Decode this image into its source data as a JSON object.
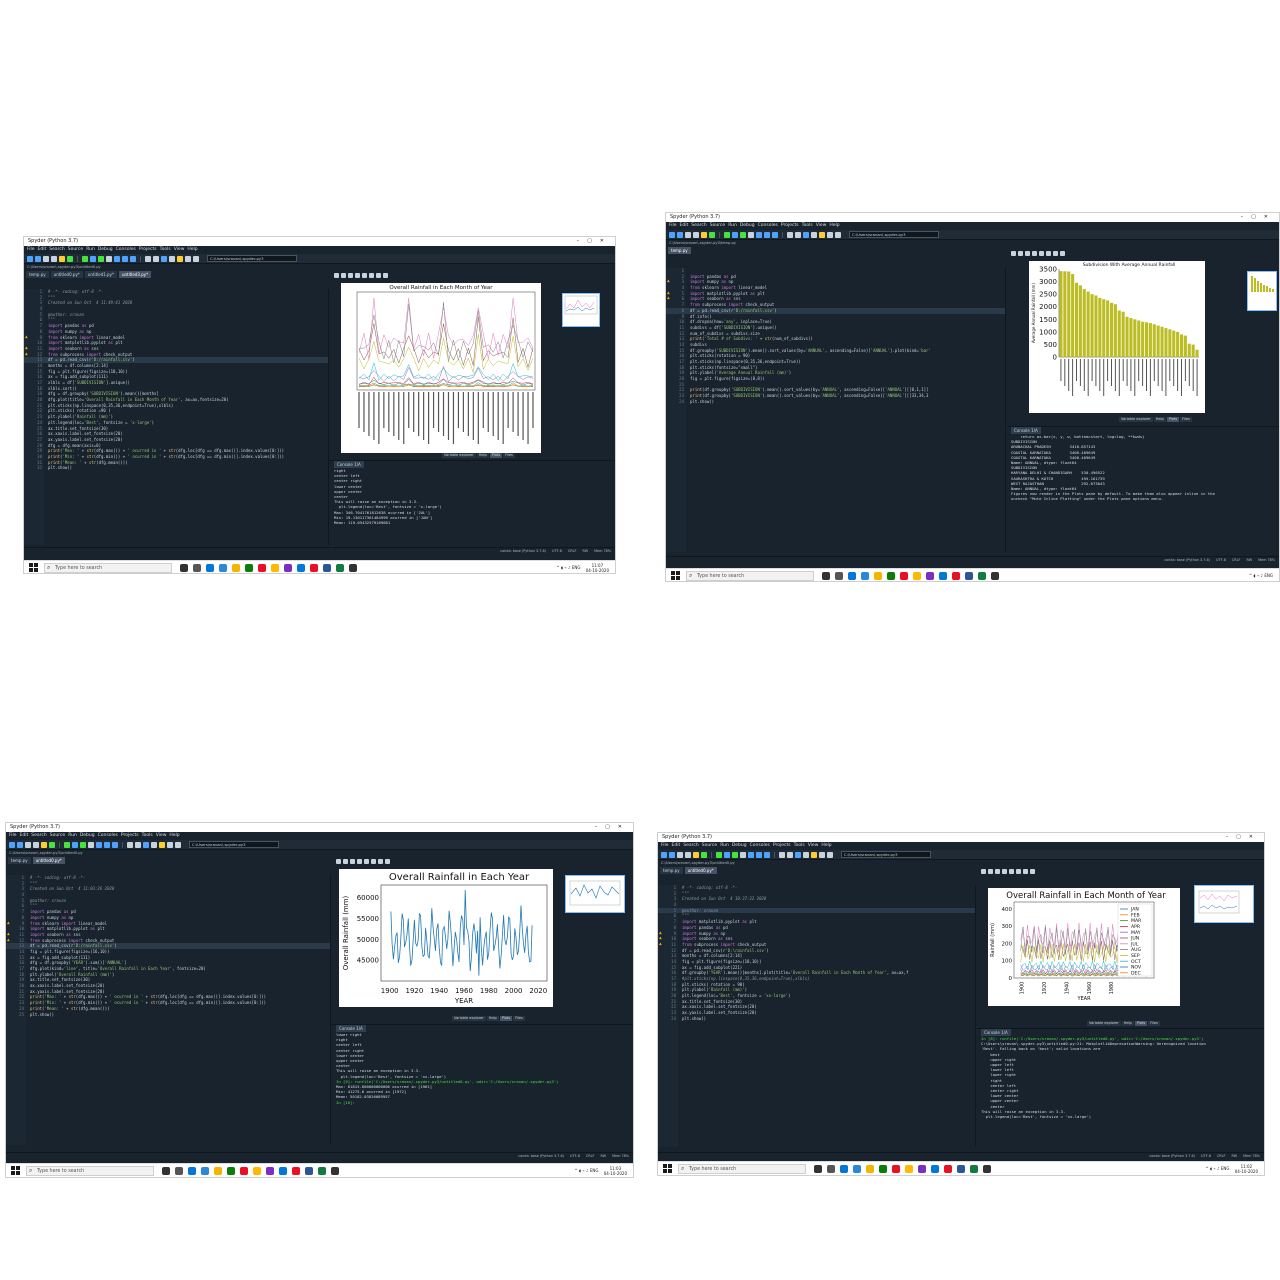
{
  "app_title": "Spyder (Python 3.7)",
  "menu": [
    "File",
    "Edit",
    "Search",
    "Source",
    "Run",
    "Debug",
    "Consoles",
    "Projects",
    "Tools",
    "View",
    "Help"
  ],
  "cwd": "C:\\Users\\sravan\\.spyder-py3",
  "taskbar": {
    "search_placeholder": "Type here to search",
    "lang": "ENG"
  },
  "status": {
    "interpreter": "conda: base (Python 3.7.6)",
    "enc": "UTF-8",
    "eol": "CRLF",
    "perm": "RW",
    "mem": "Mem 78%"
  },
  "plot_tabs": [
    "Variable explorer",
    "Help",
    "Plots",
    "Files"
  ],
  "console_tabs": [
    "Python console",
    "History"
  ],
  "screens": [
    {
      "editor_file": "C:\\Users\\sravan\\.spyder-py3\\untitled0.py",
      "tabs": [
        "temp.py",
        "untitled0.py*",
        "untitled1.py*",
        "untitled3.py*"
      ],
      "code": [
        "# -*- coding: utf-8 -*-",
        "\"\"\"",
        "Created on Sun Oct  4 11:49:41 2020",
        "",
        "@author: sravan",
        "\"\"\"",
        "import pandas as pd",
        "import numpy as np",
        "from sklearn import linear_model",
        "import matplotlib.pyplot as plt",
        "import seaborn as sns",
        "from subprocess import check_output",
        "df = pd.read_csv(r'D:/rainfall.csv')",
        "months = df.columns[2:14]",
        "fig = plt.figure(figsize=(18,10))",
        "ax = fig.add_subplot(111)",
        "xlbls = df['SUBDIVISION'].unique()",
        "xlbls.sort()",
        "dfg = df.groupby('SUBDIVISION').mean()[months]",
        "dfg.plot(title='Overall Rainfall in Each Month of Year', ax=ax,fontsize=20)",
        "plt.xticks(np.linspace(0,35,36,endpoint=True),xlbls)",
        "plt.xticks( rotation =90 )",
        "plt.ylabel('Rainfall (mm)')",
        "plt.legend(loc='Best', fontsize = 'x-large')",
        "ax.title.set_fontsize(30)",
        "ax.xaxis.label.set_fontsize(20)",
        "ax.yaxis.label.set_fontsize(20)",
        "dfg = dfg.mean(axis=0)",
        "print('Max: ' + str(dfg.max()) + ' ocurred in ' + str(dfg.loc[dfg == dfg.max()].index.values[0:]))",
        "print('Min: ' + str(dfg.min()) + ' ocurred in ' + str(dfg.loc[dfg == dfg.min()].index.values[0:]))",
        "print('Mean: ' + str(dfg.mean()))",
        "plt.show()"
      ],
      "plot_title": "Overall Rainfall in Each Month of Year",
      "console": [
        "right",
        "center left",
        "center right",
        "lower center",
        "upper center",
        "center",
        "This will raise an exception in 3.3.",
        "  plt.legend(loc='Best', fontsize = 'x-large')",
        "Max: 346.7041761812638 ocurred in ['JUL']",
        "Min: 19.130117361484999 ocurred in ['JAN']",
        "Mean: 119.05432579109881"
      ],
      "time": "11:07",
      "date": "04-10-2020"
    },
    {
      "editor_file": "C:\\Users\\sravan\\.spyder-py3\\temp.py",
      "tabs": [
        "temp.py"
      ],
      "code": [
        "",
        "import pandas as pd",
        "import numpy as np",
        "from sklearn import linear_model",
        "import matplotlib.pyplot as plt",
        "import seaborn as sns",
        "from subprocess import check_output",
        "df = pd.read_csv(r'D:/rainfall.csv')",
        "df.info()",
        "df.dropna(how='any', inplace=True)",
        "subdivs = df['SUBDIVISION'].unique()",
        "num_of_subdivs = subdivs.size",
        "print('Total # of Subdivs: ' + str(num_of_subdivs))",
        "subdivs",
        "df.groupby('SUBDIVISION').mean().sort_values(by='ANNUAL', ascending=False)['ANNUAL'].plot(kind='bar'",
        "plt.xticks(rotation = 90)",
        "plt.xticks(np.linspace(0,35,36,endpoint=True))",
        "plt.xticks(fontsize=\"small\")",
        "plt.ylabel('Average Annual Rainfall (mm)')",
        "fig = plt.figure(figsize=(8,8))",
        "",
        "print(df.groupby('SUBDIVISION').mean().sort_values(by='ANNUAL', ascending=False)['ANNUAL'][[0,1,1]]",
        "print(df.groupby('SUBDIVISION').mean().sort_values(by='ANNUAL', ascending=False)['ANNUAL'][[33,34,3",
        "plt.show()"
      ],
      "plot_title": "Subdivision With Average Annual Rainfall",
      "bar_values": [
        3418,
        3410,
        3400,
        3300,
        2950,
        2850,
        2700,
        2600,
        2500,
        2450,
        2350,
        2300,
        2250,
        2150,
        2100,
        1850,
        1800,
        1600,
        1550,
        1500,
        1450,
        1400,
        1380,
        1350,
        1300,
        1250,
        1200,
        1150,
        1100,
        1050,
        1000,
        900,
        850,
        530,
        495,
        292
      ],
      "yticks": [
        "3500",
        "3000",
        "2500",
        "2000",
        "1500",
        "1000",
        "500",
        "0"
      ],
      "ylabel": "Average Annual Rainfall (mm)",
      "console": [
        "    return ax.bar(x, y, w, bottom=start, log=log, **kwds)",
        "SUBDIVISION",
        "ARUNACHAL PRADESH        3418.857143",
        "COASTAL KARNATAKA        3408.409649",
        "COASTAL KARNATAKA        3408.409649",
        "Name: ANNUAL, dtype: float64",
        "SUBDIVISION",
        "HARYANA DELHI & CHANDIGARH    530.496522",
        "SAURASHTRA & KUTCH            495.161739",
        "WEST RAJASTHAN                292.673043",
        "Name: ANNUAL, dtype: float64",
        "",
        "",
        "Figures now render in the Plots pane by default. To make them also appear inline in the",
        "uncheck \"Mute Inline Plotting\" under the Plots pane options menu."
      ],
      "time": "",
      "date": ""
    },
    {
      "editor_file": "C:\\Users\\sravan\\.spyder-py3\\untitled0.py",
      "tabs": [
        "temp.py",
        "untitled0.py*"
      ],
      "code": [
        "# -*- coding: utf-8 -*-",
        "\"\"\"",
        "Created on Sun Oct  4 11:03:26 2020",
        "",
        "@author: sravan",
        "\"\"\"",
        "import pandas as pd",
        "import numpy as np",
        "from sklearn import linear_model",
        "import matplotlib.pyplot as plt",
        "import seaborn as sns",
        "from subprocess import check_output",
        "df = pd.read_csv(r'D:/rainfall.csv')",
        "fig = plt.figure(figsize=(16,10))",
        "ax = fig.add_subplot(111)",
        "dfg = df.groupby('YEAR').sum()['ANNUAL']",
        "dfg.plot(kind='line', title='Overall Rainfall in Each Year', fontsize=20)",
        "plt.ylabel('Overall Rainfall (mm)')",
        "ax.title.set_fontsize(30)",
        "ax.xaxis.label.set_fontsize(20)",
        "ax.yaxis.label.set_fontsize(20)",
        "print('Max: ' + str(dfg.max()) + ' ocurred in ' + str(dfg.loc[dfg == dfg.max()].index.values[0:]))",
        "print('Min: ' + str(dfg.min()) + ' ocurred in ' + str(dfg.loc[dfg == dfg.min()].index.values[0:]))",
        "print('Mean: ' + str(dfg.mean()))",
        "plt.show()"
      ],
      "plot_title": "Overall Rainfall in Each Year",
      "ylabel": "Overall Rainfall (mm)",
      "xlabel": "YEAR",
      "xticks": [
        "1900",
        "1920",
        "1940",
        "1960",
        "1980",
        "2000",
        "2020"
      ],
      "yticks": [
        "60000",
        "55000",
        "50000",
        "45000"
      ],
      "console": [
        "lower right",
        "right",
        "center left",
        "center right",
        "lower center",
        "upper center",
        "center",
        "This will raise an exception in 3.3.",
        "  plt.legend(loc='Best', fontsize = 'xx-large')",
        "",
        "In [9]: runfile('C:/Users/sravan/.spyder-py3/untitled0.py', wdir='C:/Users/sravan/.spyder-py3')",
        "Max: 61815.600000000006 ocurred in [1961]",
        "Min: 41275.6 ocurred in [1972]",
        "Mean: 50182.03826089957",
        "",
        "In [10]:"
      ],
      "time": "11:03",
      "date": "04-10-2020"
    },
    {
      "editor_file": "C:\\Users\\sravan\\.spyder-py3\\untitled0.py",
      "tabs": [
        "temp.py",
        "untitled0.py*"
      ],
      "code": [
        "# -*- coding: utf-8 -*-",
        "\"\"\"",
        "Created on Sun Oct  4 10:37:32 2020",
        "",
        "@author: sravan",
        "\"\"\"",
        "import matplotlib.pyplot as plt",
        "import pandas as pd",
        "import numpy as np",
        "import seaborn as sns",
        "from subprocess import check_output",
        "df = pd.read_csv(r'D:\\rainfall.csv')",
        "months = df.columns[2:14]",
        "fig = plt.figure(figsize=(18,10))",
        "ax = fig.add_subplot(221)",
        "df.groupby('YEAR').mean()[months].plot(title='Overall Rainfall in Each Month of Year', ax=ax,f",
        "#plt.xticks(np.linspace(0,35,36,endpoint=True),xlbls)",
        "plt.xticks( rotation = 90)",
        "plt.ylabel('Rainfall (mm)')",
        "plt.legend(loc='Best', fontsize = 'xx-large')",
        "ax.title.set_fontsize(30)",
        "ax.xaxis.label.set_fontsize(20)",
        "ax.yaxis.label.set_fontsize(20)",
        "plt.show()"
      ],
      "plot_title": "Overall Rainfall in Each Month of Year",
      "ylabel": "Rainfall (mm)",
      "xlabel": "YEAR",
      "xticks": [
        "1900",
        "1920",
        "1940",
        "1960",
        "1980"
      ],
      "yticks": [
        "400",
        "300",
        "200",
        "100",
        "0"
      ],
      "legend": [
        "JAN",
        "FEB",
        "MAR",
        "APR",
        "MAY",
        "JUN",
        "JUL",
        "AUG",
        "SEP",
        "OCT",
        "NOV",
        "DEC"
      ],
      "console": [
        "In [8]: runfile('C:/Users/sravan/.spyder-py3/untitled0.py', wdir='C:/Users/sravan/.spyder-py3')",
        "C:\\Users\\sravan\\.spyder-py3\\untitled0.py:21: MatplotlibDeprecationWarning: Unrecognized location",
        "'Best'. Falling back on 'best'; valid locations are",
        "    best",
        "    upper right",
        "    upper left",
        "    lower left",
        "    lower right",
        "    right",
        "    center left",
        "    center right",
        "    lower center",
        "    upper center",
        "    center",
        "This will raise an exception in 3.3.",
        "  plt.legend(loc='Best', fontsize = 'xx-large')"
      ],
      "time": "11:02",
      "date": "04-10-2020"
    }
  ]
}
